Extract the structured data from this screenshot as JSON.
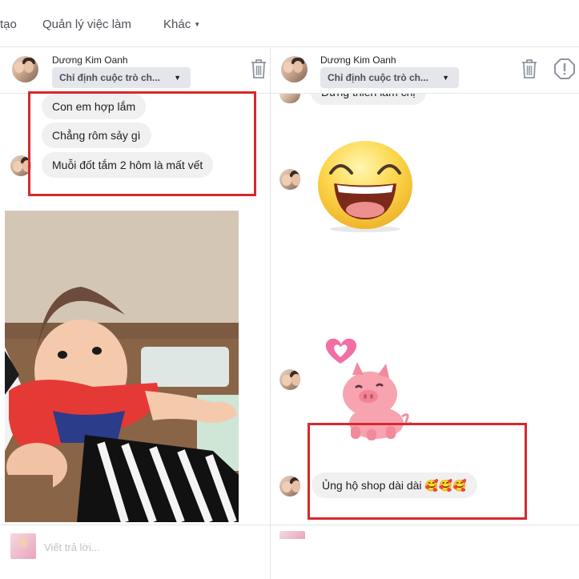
{
  "nav": {
    "item_partial": "tạo",
    "item_jobs": "Quản lý việc làm",
    "item_more": "Khác"
  },
  "left_panel": {
    "sender": "Dương Kim Oanh",
    "assign_label": "Chỉ định cuộc trò ch...",
    "messages": [
      "Con em hợp lắm",
      "Chẳng rôm sảy gì",
      "Muỗi đốt tắm 2 hôm là mất vết"
    ],
    "reply_placeholder": "Viết trả lời..."
  },
  "right_panel": {
    "sender": "Dương Kim Oanh",
    "assign_label": "Chỉ định cuộc trò ch...",
    "top_partial_message": "Đừng thiên lâm chị",
    "message": "Ủng hộ shop dài dài 🥰🥰🥰"
  },
  "colors": {
    "highlight_box": "#d7282f",
    "bubble_bg": "#f0f0f0"
  },
  "icons": [
    "trash-icon",
    "report-icon",
    "dropdown-caret-icon",
    "laughing-emoji-sticker",
    "pig-heart-sticker"
  ]
}
